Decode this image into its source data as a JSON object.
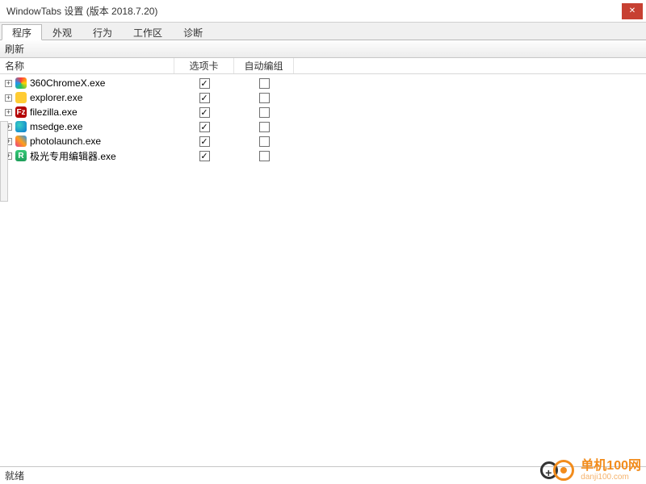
{
  "window": {
    "title": "WindowTabs 设置 (版本 2018.7.20)"
  },
  "tabs": [
    {
      "label": "程序",
      "active": true
    },
    {
      "label": "外观",
      "active": false
    },
    {
      "label": "行为",
      "active": false
    },
    {
      "label": "工作区",
      "active": false
    },
    {
      "label": "诊断",
      "active": false
    }
  ],
  "toolbar": {
    "refresh_label": "刷新"
  },
  "columns": {
    "name": "名称",
    "tabs": "选项卡",
    "auto": "自动编组"
  },
  "programs": [
    {
      "name": "360ChromeX.exe",
      "icon_color_bg": "conic-gradient(#ff3b3b,#ffd400,#22c55e,#2196f3,#ff3b3b)",
      "icon_text": "",
      "tabs_checked": true,
      "auto_checked": false
    },
    {
      "name": "explorer.exe",
      "icon_color_bg": "#ffcc33",
      "icon_text": "",
      "tabs_checked": true,
      "auto_checked": false
    },
    {
      "name": "filezilla.exe",
      "icon_color_bg": "#b40000",
      "icon_text": "Fz",
      "tabs_checked": true,
      "auto_checked": false
    },
    {
      "name": "msedge.exe",
      "icon_color_bg": "radial-gradient(circle at 35% 35%, #39d0c4, #0b78d0)",
      "icon_text": "",
      "tabs_checked": true,
      "auto_checked": false
    },
    {
      "name": "photolaunch.exe",
      "icon_color_bg": "linear-gradient(45deg,#e83e8c,#ff9f1a,#2196f3)",
      "icon_text": "",
      "tabs_checked": true,
      "auto_checked": false
    },
    {
      "name": "极光专用编辑器.exe",
      "icon_color_bg": "linear-gradient(#37c978,#1e9e5a)",
      "icon_text": "R",
      "tabs_checked": true,
      "auto_checked": false
    }
  ],
  "statusbar": {
    "text": "就绪"
  },
  "watermark": {
    "line1": "单机100网",
    "line2": "danji100.com"
  }
}
